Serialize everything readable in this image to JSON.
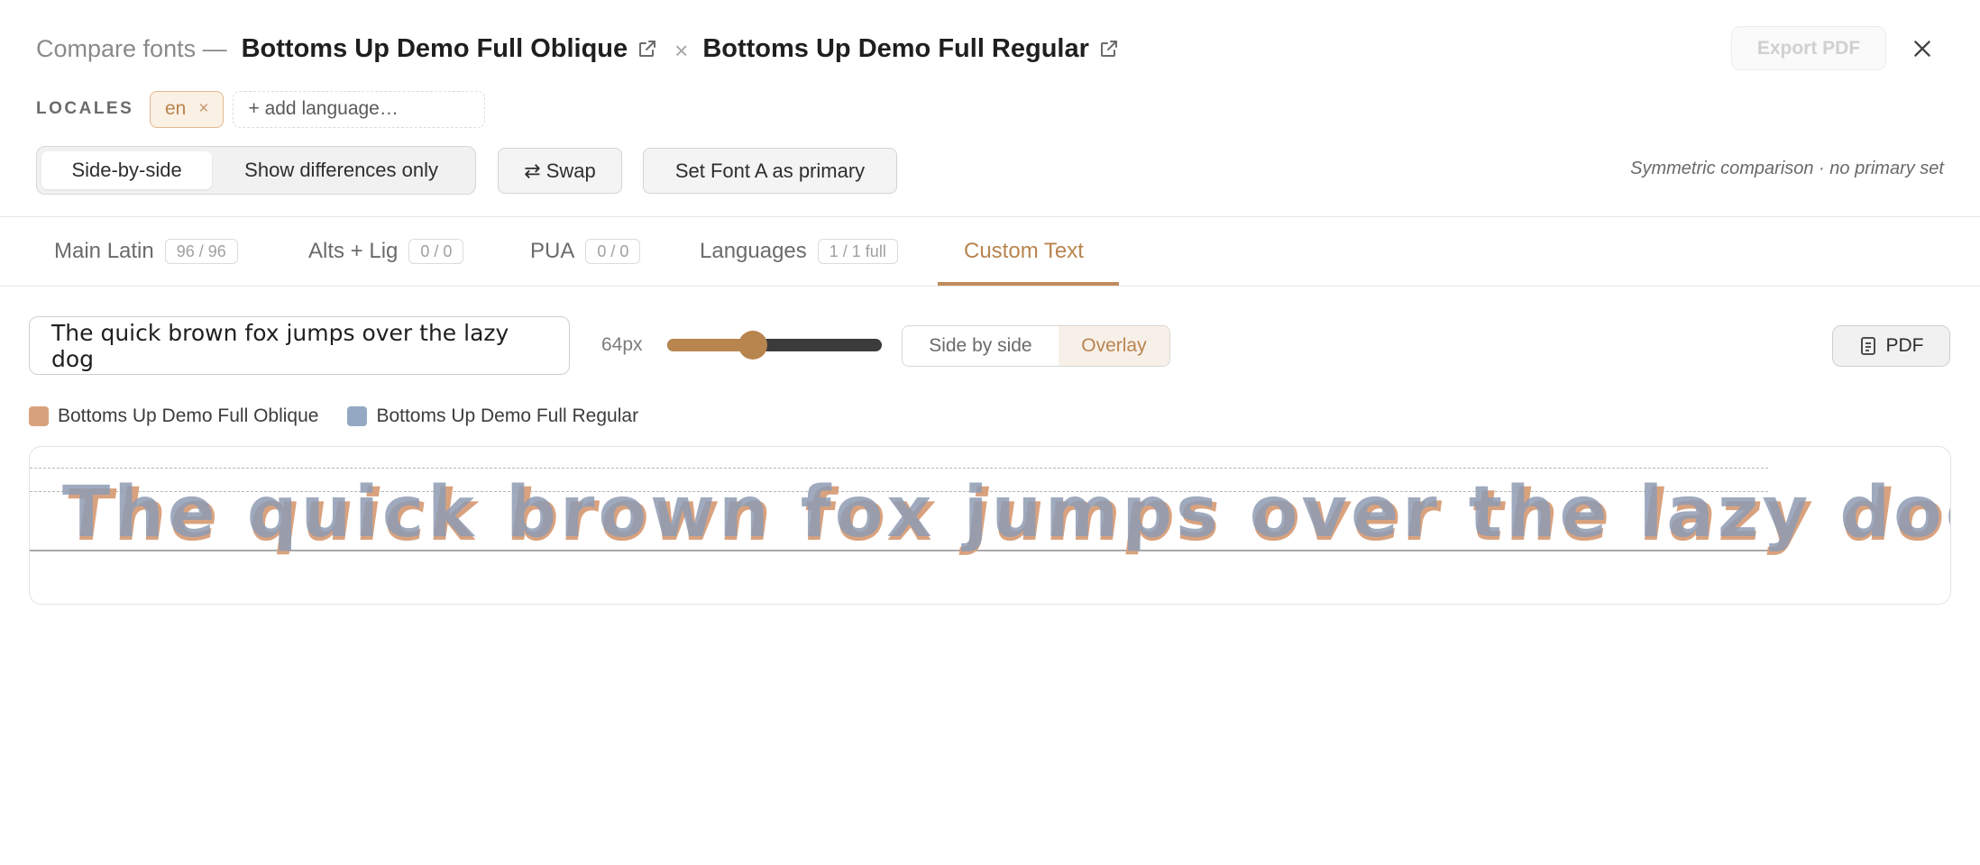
{
  "header": {
    "prefix": "Compare fonts —",
    "font_a": "Bottoms Up Demo Full Oblique",
    "separator": "×",
    "font_b": "Bottoms Up Demo Full Regular",
    "export_label": "Export PDF"
  },
  "locales": {
    "label": "LOCALES",
    "chips": [
      {
        "code": "en",
        "remove": "×"
      }
    ],
    "add_placeholder": "+ add language…"
  },
  "view_mode": {
    "options": [
      "Side-by-side",
      "Show differences only"
    ],
    "selected": "Side-by-side"
  },
  "actions": {
    "swap_label": "⇄ Swap",
    "set_primary_label": "Set Font A as primary"
  },
  "status_note": "Symmetric comparison · no primary set",
  "tabs": [
    {
      "label": "Main Latin",
      "badge": "96 / 96"
    },
    {
      "label": "Alts + Lig",
      "badge": "0 / 0"
    },
    {
      "label": "PUA",
      "badge": "0 / 0"
    },
    {
      "label": "Languages",
      "badge": "1 / 1 full"
    },
    {
      "label": "Custom Text",
      "badge": ""
    }
  ],
  "active_tab": "Custom Text",
  "custom_text": {
    "input_value": "The quick brown fox jumps over the lazy dog",
    "size_label": "64px",
    "size_fraction": 0.4,
    "display_modes": [
      "Side by side",
      "Overlay"
    ],
    "selected_display": "Overlay",
    "pdf_label": "PDF"
  },
  "legend": [
    {
      "name": "Bottoms Up Demo Full Oblique",
      "color": "#d9a27e"
    },
    {
      "name": "Bottoms Up Demo Full Regular",
      "color": "#94a8c4"
    }
  ],
  "preview": {
    "sample_text": "The quick brown fox jumps over the lazy dog"
  },
  "colors": {
    "accent": "#b8844f",
    "font_a": "#d9a27e",
    "font_b": "#94a8c4"
  }
}
